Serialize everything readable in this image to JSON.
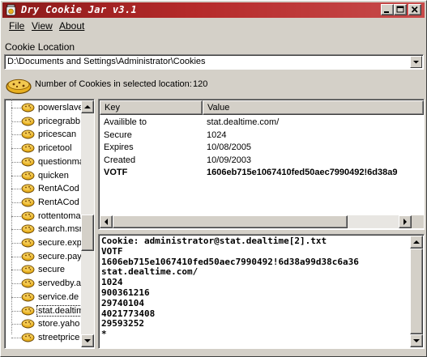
{
  "window": {
    "title": "Dry Cookie Jar v3.1",
    "colors": {
      "titlebar": "#8b1a1a",
      "face": "#d4d0c8",
      "cookie": "#e8b020"
    }
  },
  "menu": {
    "file": "File",
    "view": "View",
    "about": "About"
  },
  "location": {
    "label": "Cookie Location",
    "value": "D:\\Documents and Settings\\Administrator\\Cookies"
  },
  "count": {
    "label": "Number of Cookies in selected location:",
    "value": "120"
  },
  "tree": {
    "items": [
      {
        "label": "powerslave"
      },
      {
        "label": "pricegrabb"
      },
      {
        "label": "pricescan"
      },
      {
        "label": "pricetool"
      },
      {
        "label": "questionma"
      },
      {
        "label": "quicken"
      },
      {
        "label": "RentACod"
      },
      {
        "label": "RentACod"
      },
      {
        "label": "rottentoma"
      },
      {
        "label": "search.msr"
      },
      {
        "label": "secure.exp"
      },
      {
        "label": "secure.pay"
      },
      {
        "label": "secure"
      },
      {
        "label": "servedby.a"
      },
      {
        "label": "service.de"
      },
      {
        "label": "stat.dealtim"
      },
      {
        "label": "store.yaho"
      },
      {
        "label": "streetprice"
      }
    ],
    "selected_index": 15
  },
  "details": {
    "headers": {
      "key": "Key",
      "value": "Value"
    },
    "rows": [
      {
        "key": "Availible to",
        "value": "stat.dealtime.com/",
        "bold": false
      },
      {
        "key": "Secure",
        "value": "1024",
        "bold": false
      },
      {
        "key": "Expires",
        "value": "10/08/2005",
        "bold": false
      },
      {
        "key": "Created",
        "value": "10/09/2003",
        "bold": false
      },
      {
        "key": "VOTF",
        "value": "1606eb715e1067410fed50aec7990492!6d38a9",
        "bold": true
      }
    ]
  },
  "raw": {
    "lines": [
      "Cookie: administrator@stat.dealtime[2].txt",
      "VOTF",
      "1606eb715e1067410fed50aec7990492!6d38a99d38c6a36",
      "stat.dealtime.com/",
      "1024",
      "900361216",
      "29740104",
      "4021773408",
      "29593252",
      "*"
    ]
  }
}
